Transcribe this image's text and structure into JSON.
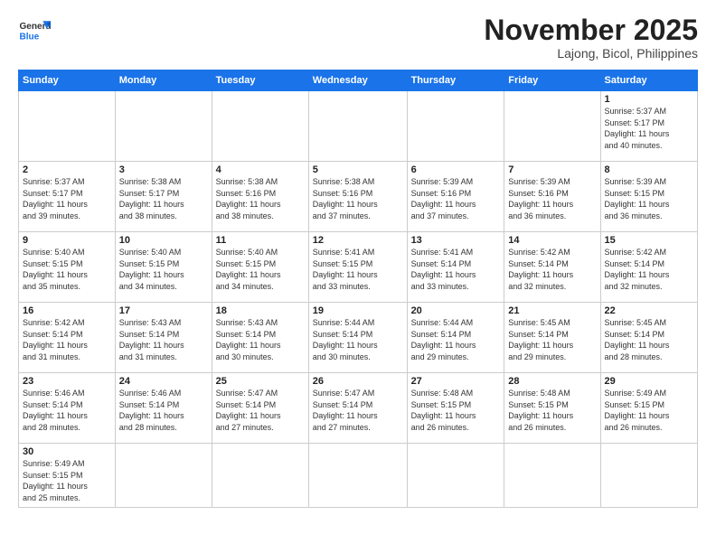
{
  "header": {
    "logo_general": "General",
    "logo_blue": "Blue",
    "month_title": "November 2025",
    "location": "Lajong, Bicol, Philippines"
  },
  "weekdays": [
    "Sunday",
    "Monday",
    "Tuesday",
    "Wednesday",
    "Thursday",
    "Friday",
    "Saturday"
  ],
  "weeks": [
    [
      {
        "day": "",
        "info": ""
      },
      {
        "day": "",
        "info": ""
      },
      {
        "day": "",
        "info": ""
      },
      {
        "day": "",
        "info": ""
      },
      {
        "day": "",
        "info": ""
      },
      {
        "day": "",
        "info": ""
      },
      {
        "day": "1",
        "info": "Sunrise: 5:37 AM\nSunset: 5:17 PM\nDaylight: 11 hours\nand 40 minutes."
      }
    ],
    [
      {
        "day": "2",
        "info": "Sunrise: 5:37 AM\nSunset: 5:17 PM\nDaylight: 11 hours\nand 39 minutes."
      },
      {
        "day": "3",
        "info": "Sunrise: 5:38 AM\nSunset: 5:17 PM\nDaylight: 11 hours\nand 38 minutes."
      },
      {
        "day": "4",
        "info": "Sunrise: 5:38 AM\nSunset: 5:16 PM\nDaylight: 11 hours\nand 38 minutes."
      },
      {
        "day": "5",
        "info": "Sunrise: 5:38 AM\nSunset: 5:16 PM\nDaylight: 11 hours\nand 37 minutes."
      },
      {
        "day": "6",
        "info": "Sunrise: 5:39 AM\nSunset: 5:16 PM\nDaylight: 11 hours\nand 37 minutes."
      },
      {
        "day": "7",
        "info": "Sunrise: 5:39 AM\nSunset: 5:16 PM\nDaylight: 11 hours\nand 36 minutes."
      },
      {
        "day": "8",
        "info": "Sunrise: 5:39 AM\nSunset: 5:15 PM\nDaylight: 11 hours\nand 36 minutes."
      }
    ],
    [
      {
        "day": "9",
        "info": "Sunrise: 5:40 AM\nSunset: 5:15 PM\nDaylight: 11 hours\nand 35 minutes."
      },
      {
        "day": "10",
        "info": "Sunrise: 5:40 AM\nSunset: 5:15 PM\nDaylight: 11 hours\nand 34 minutes."
      },
      {
        "day": "11",
        "info": "Sunrise: 5:40 AM\nSunset: 5:15 PM\nDaylight: 11 hours\nand 34 minutes."
      },
      {
        "day": "12",
        "info": "Sunrise: 5:41 AM\nSunset: 5:15 PM\nDaylight: 11 hours\nand 33 minutes."
      },
      {
        "day": "13",
        "info": "Sunrise: 5:41 AM\nSunset: 5:14 PM\nDaylight: 11 hours\nand 33 minutes."
      },
      {
        "day": "14",
        "info": "Sunrise: 5:42 AM\nSunset: 5:14 PM\nDaylight: 11 hours\nand 32 minutes."
      },
      {
        "day": "15",
        "info": "Sunrise: 5:42 AM\nSunset: 5:14 PM\nDaylight: 11 hours\nand 32 minutes."
      }
    ],
    [
      {
        "day": "16",
        "info": "Sunrise: 5:42 AM\nSunset: 5:14 PM\nDaylight: 11 hours\nand 31 minutes."
      },
      {
        "day": "17",
        "info": "Sunrise: 5:43 AM\nSunset: 5:14 PM\nDaylight: 11 hours\nand 31 minutes."
      },
      {
        "day": "18",
        "info": "Sunrise: 5:43 AM\nSunset: 5:14 PM\nDaylight: 11 hours\nand 30 minutes."
      },
      {
        "day": "19",
        "info": "Sunrise: 5:44 AM\nSunset: 5:14 PM\nDaylight: 11 hours\nand 30 minutes."
      },
      {
        "day": "20",
        "info": "Sunrise: 5:44 AM\nSunset: 5:14 PM\nDaylight: 11 hours\nand 29 minutes."
      },
      {
        "day": "21",
        "info": "Sunrise: 5:45 AM\nSunset: 5:14 PM\nDaylight: 11 hours\nand 29 minutes."
      },
      {
        "day": "22",
        "info": "Sunrise: 5:45 AM\nSunset: 5:14 PM\nDaylight: 11 hours\nand 28 minutes."
      }
    ],
    [
      {
        "day": "23",
        "info": "Sunrise: 5:46 AM\nSunset: 5:14 PM\nDaylight: 11 hours\nand 28 minutes."
      },
      {
        "day": "24",
        "info": "Sunrise: 5:46 AM\nSunset: 5:14 PM\nDaylight: 11 hours\nand 28 minutes."
      },
      {
        "day": "25",
        "info": "Sunrise: 5:47 AM\nSunset: 5:14 PM\nDaylight: 11 hours\nand 27 minutes."
      },
      {
        "day": "26",
        "info": "Sunrise: 5:47 AM\nSunset: 5:14 PM\nDaylight: 11 hours\nand 27 minutes."
      },
      {
        "day": "27",
        "info": "Sunrise: 5:48 AM\nSunset: 5:15 PM\nDaylight: 11 hours\nand 26 minutes."
      },
      {
        "day": "28",
        "info": "Sunrise: 5:48 AM\nSunset: 5:15 PM\nDaylight: 11 hours\nand 26 minutes."
      },
      {
        "day": "29",
        "info": "Sunrise: 5:49 AM\nSunset: 5:15 PM\nDaylight: 11 hours\nand 26 minutes."
      }
    ],
    [
      {
        "day": "30",
        "info": "Sunrise: 5:49 AM\nSunset: 5:15 PM\nDaylight: 11 hours\nand 25 minutes."
      },
      {
        "day": "",
        "info": ""
      },
      {
        "day": "",
        "info": ""
      },
      {
        "day": "",
        "info": ""
      },
      {
        "day": "",
        "info": ""
      },
      {
        "day": "",
        "info": ""
      },
      {
        "day": "",
        "info": ""
      }
    ]
  ]
}
